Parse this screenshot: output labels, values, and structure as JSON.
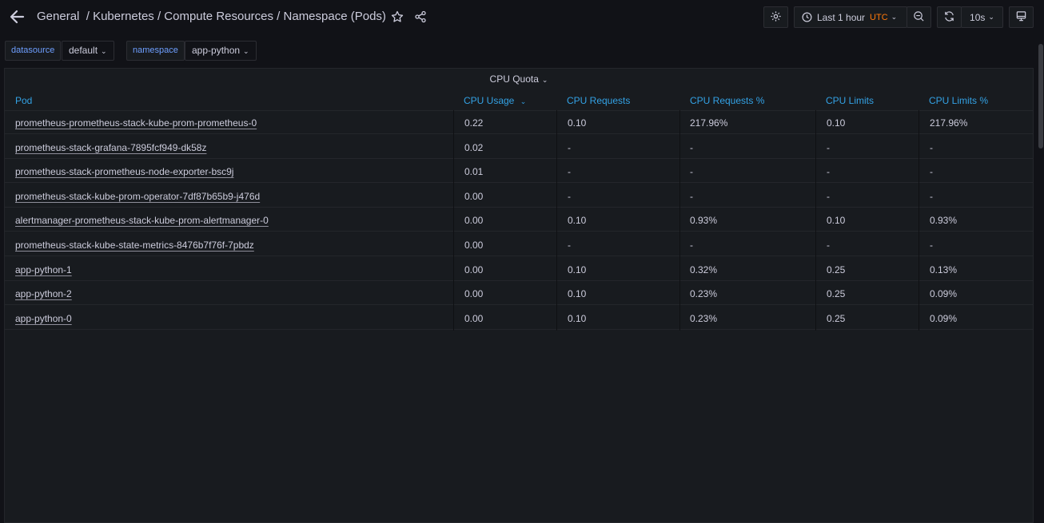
{
  "header": {
    "folder": "General",
    "separator": "/",
    "dashboard": "Kubernetes / Compute Resources / Namespace (Pods)",
    "time_range": "Last 1 hour",
    "timezone": "UTC",
    "refresh": "10s"
  },
  "variables": [
    {
      "label": "datasource",
      "value": "default"
    },
    {
      "label": "namespace",
      "value": "app-python"
    }
  ],
  "panel": {
    "title": "CPU Quota",
    "columns": [
      "Pod",
      "CPU Usage",
      "CPU Requests",
      "CPU Requests %",
      "CPU Limits",
      "CPU Limits %"
    ],
    "rows": [
      [
        "prometheus-prometheus-stack-kube-prom-prometheus-0",
        "0.22",
        "0.10",
        "217.96%",
        "0.10",
        "217.96%"
      ],
      [
        "prometheus-stack-grafana-7895fcf949-dk58z",
        "0.02",
        "-",
        "-",
        "-",
        "-"
      ],
      [
        "prometheus-stack-prometheus-node-exporter-bsc9j",
        "0.01",
        "-",
        "-",
        "-",
        "-"
      ],
      [
        "prometheus-stack-kube-prom-operator-7df87b65b9-j476d",
        "0.00",
        "-",
        "-",
        "-",
        "-"
      ],
      [
        "alertmanager-prometheus-stack-kube-prom-alertmanager-0",
        "0.00",
        "0.10",
        "0.93%",
        "0.10",
        "0.93%"
      ],
      [
        "prometheus-stack-kube-state-metrics-8476b7f76f-7pbdz",
        "0.00",
        "-",
        "-",
        "-",
        "-"
      ],
      [
        "app-python-1",
        "0.00",
        "0.10",
        "0.32%",
        "0.25",
        "0.13%"
      ],
      [
        "app-python-2",
        "0.00",
        "0.10",
        "0.23%",
        "0.25",
        "0.09%"
      ],
      [
        "app-python-0",
        "0.00",
        "0.10",
        "0.23%",
        "0.25",
        "0.09%"
      ]
    ]
  }
}
